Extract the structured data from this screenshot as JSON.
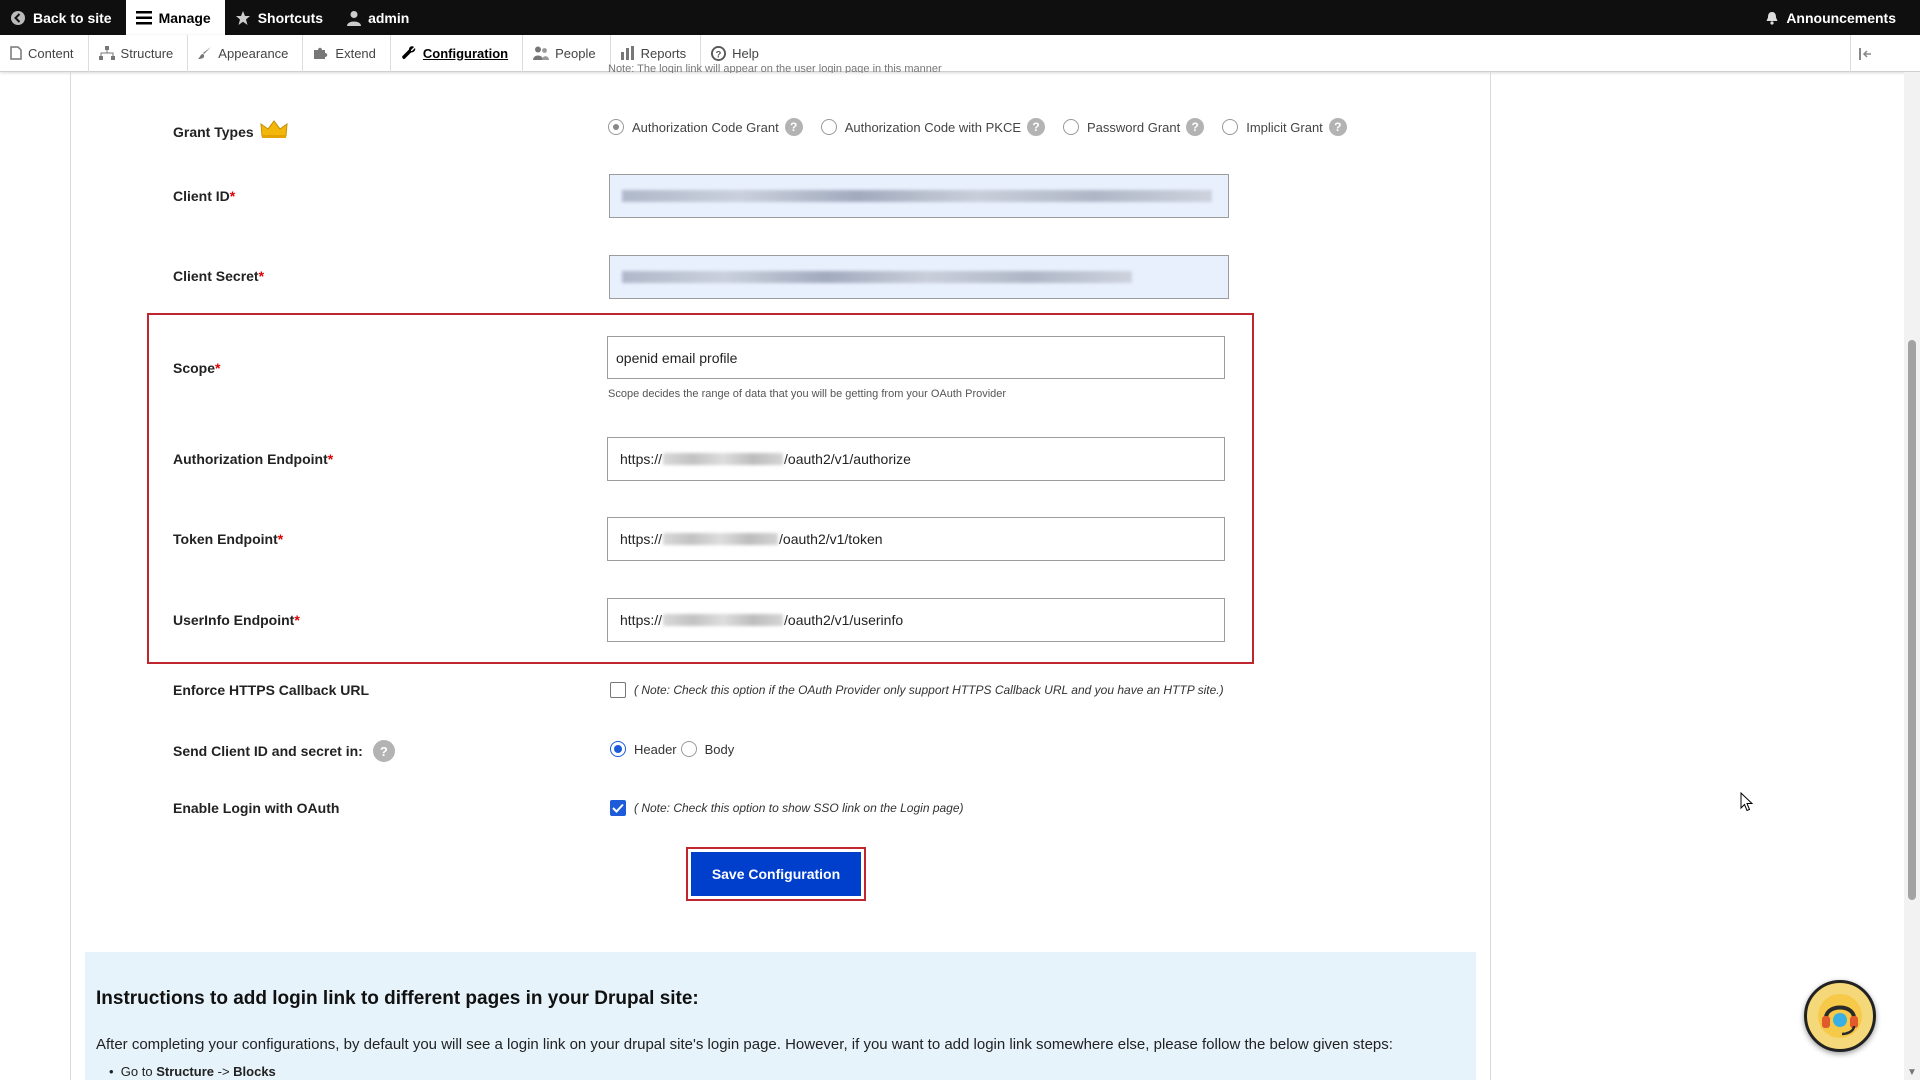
{
  "toolbar": {
    "back_to_site": "Back to site",
    "manage": "Manage",
    "shortcuts": "Shortcuts",
    "user": "admin",
    "announcements": "Announcements"
  },
  "tray": {
    "items": [
      "Content",
      "Structure",
      "Appearance",
      "Extend",
      "Configuration",
      "People",
      "Reports",
      "Help"
    ],
    "current": "Configuration"
  },
  "form": {
    "note_cutoff": "Note: The login link will appear on the user login page in this manner",
    "grant_types": {
      "label": "Grant Types",
      "options": [
        "Authorization Code Grant",
        "Authorization Code with PKCE",
        "Password Grant",
        "Implicit Grant"
      ],
      "selected": "Authorization Code Grant",
      "help": "?"
    },
    "client_id": {
      "label": "Client ID"
    },
    "client_secret": {
      "label": "Client Secret"
    },
    "scope": {
      "label": "Scope",
      "value": "openid email profile",
      "help": "Scope decides the range of data that you will be getting from your OAuth Provider"
    },
    "authorization_endpoint": {
      "label": "Authorization Endpoint",
      "prefix": "https://",
      "suffix": "/oauth2/v1/authorize"
    },
    "token_endpoint": {
      "label": "Token Endpoint",
      "prefix": "https://",
      "suffix": "/oauth2/v1/token"
    },
    "userinfo_endpoint": {
      "label": "UserInfo Endpoint",
      "prefix": "https://",
      "suffix": "/oauth2/v1/userinfo"
    },
    "required_marker": "*",
    "enforce_https": {
      "label": "Enforce HTTPS Callback URL",
      "note": "( Note: Check this option if the OAuth Provider only support HTTPS Callback URL and you have an HTTP site.)",
      "checked": false
    },
    "send_client": {
      "label": "Send Client ID and secret in:",
      "options": [
        "Header",
        "Body"
      ],
      "selected": "Header"
    },
    "enable_login": {
      "label": "Enable Login with OAuth",
      "note": "( Note: Check this option to show SSO link on the Login page)",
      "checked": true
    },
    "save_label": "Save Configuration"
  },
  "instructions": {
    "title": "Instructions to add login link to different pages in your Drupal site:",
    "body": "After completing your configurations, by default you will see a login link on your drupal site's login page. However, if you want to add login link somewhere else, please follow the below given steps:",
    "step1_prefix": "Go to ",
    "step1_a": "Structure",
    "step1_sep": " -> ",
    "step1_b": "Blocks"
  },
  "colors": {
    "accent": "#003ecc",
    "highlight": "#c0262d",
    "required": "#dd0000",
    "instructions_bg": "#e6f3fb"
  }
}
